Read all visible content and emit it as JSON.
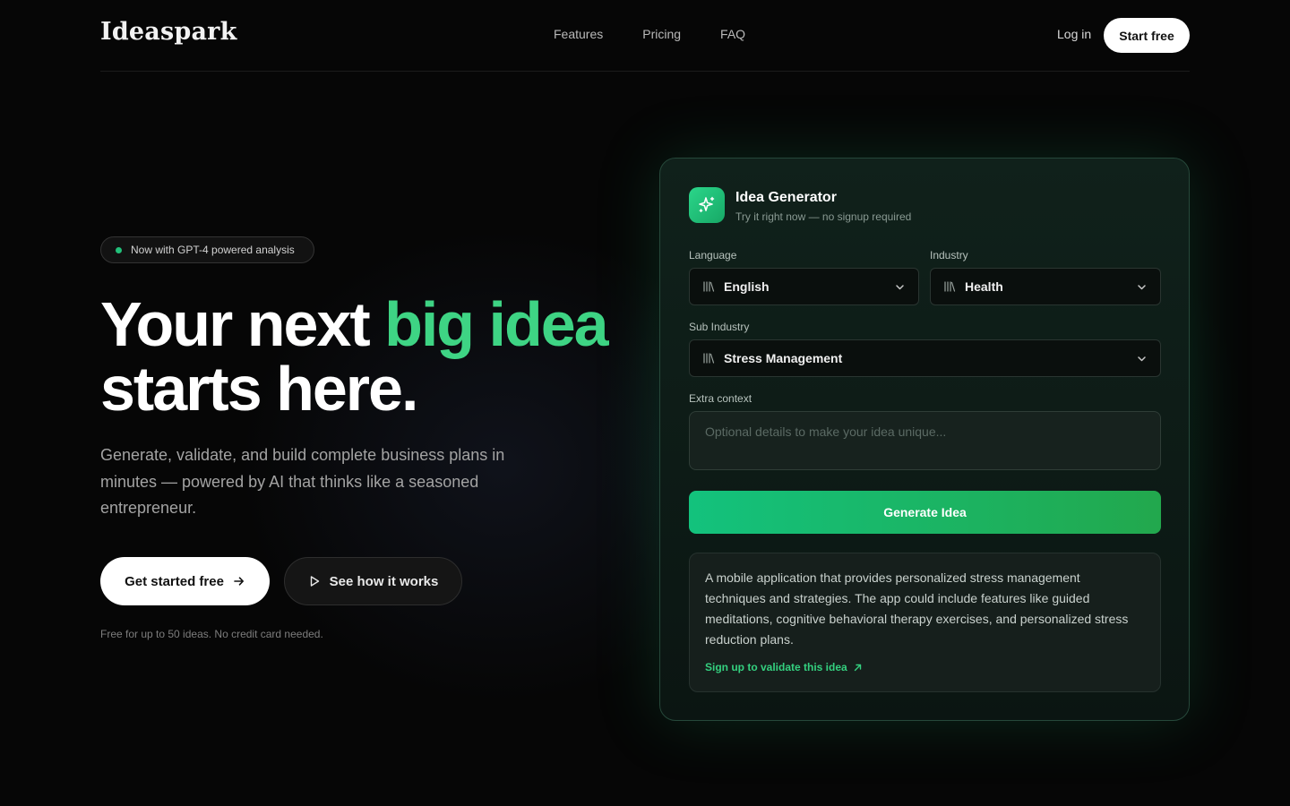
{
  "brand": {
    "name": "Ideaspark",
    "accent": "#3ed484",
    "background": "#060606"
  },
  "nav": {
    "links": [
      "Features",
      "Pricing",
      "FAQ"
    ],
    "login": "Log in",
    "cta": "Start free"
  },
  "hero": {
    "badge": "Now with GPT-4 powered analysis",
    "headline_part1": "Your next ",
    "headline_accent": "big idea",
    "headline_part2": "starts here.",
    "subtext": "Generate, validate, and build complete business plans in minutes — powered by AI that thinks like a seasoned entrepreneur.",
    "primary_cta": "Get started free",
    "secondary_cta": "See how it works",
    "fine_print": "Free for up to 50 ideas. No credit card needed."
  },
  "generator": {
    "title": "Idea Generator",
    "subtitle": "Try it right now — no signup required",
    "language_label": "Language",
    "language_value": "English",
    "industry_label": "Industry",
    "industry_value": "Health",
    "sub_industry_label": "Sub Industry",
    "sub_industry_value": "Stress Management",
    "context_label": "Extra context",
    "context_placeholder": "Optional details to make your idea unique...",
    "context_value": "",
    "generate_label": "Generate Idea",
    "result_text": "A mobile application that provides personalized stress management techniques and strategies. The app could include features like guided meditations, cognitive behavioral therapy exercises, and personalized stress reduction plans.",
    "result_link": "Sign up to validate this idea"
  },
  "icons": {
    "card": "sparkles-icon",
    "select_prefix": "library-icon",
    "select_suffix": "chevron-down-icon",
    "primary_cta": "arrow-right-icon",
    "secondary_cta": "play-icon",
    "result_link": "arrow-up-right-icon"
  }
}
